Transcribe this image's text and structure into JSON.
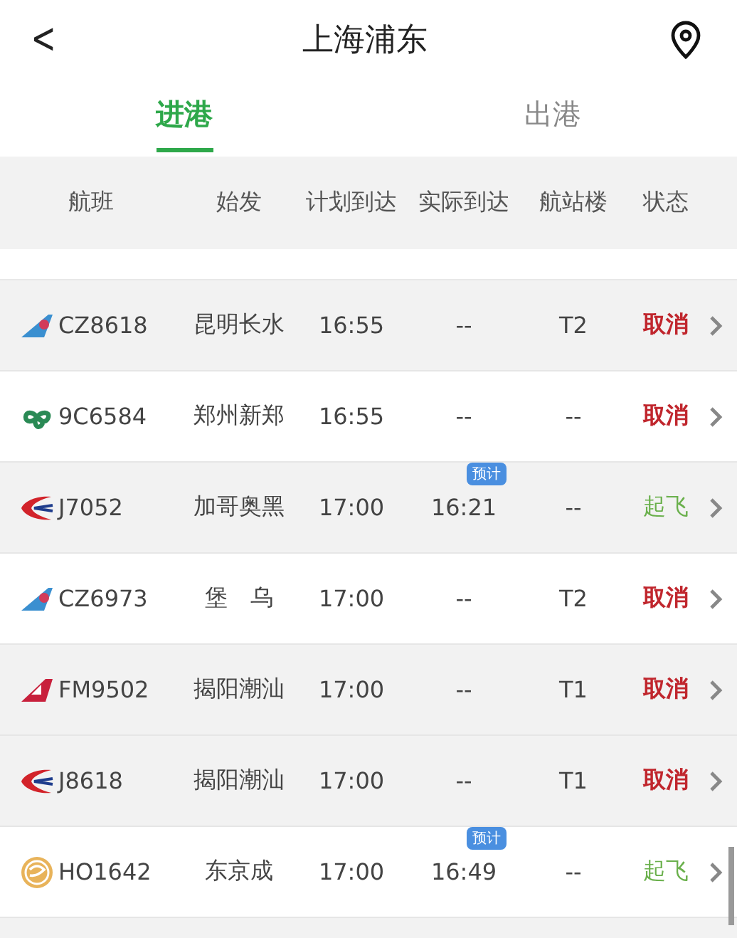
{
  "header": {
    "back": "<",
    "title": "上海浦东"
  },
  "tabs": [
    {
      "label": "进港",
      "selected": true
    },
    {
      "label": "出港",
      "selected": false
    }
  ],
  "table": {
    "columns": [
      "航班",
      "始发",
      "计划到达",
      "实际到达",
      "航站楼",
      "状态"
    ],
    "rows": [
      {
        "logo": {
          "kind": "wing"
        },
        "flight": "CZ8618",
        "origin": "昆明长水",
        "planned": "16:55",
        "actual": "--",
        "terminal": "T2",
        "status": "取消",
        "kind": "cancelled",
        "highlighted": true
      },
      {
        "logo": {
          "kind": "clover"
        },
        "flight": "9C6584",
        "origin": "郑州新郑",
        "planned": "16:55",
        "actual": "--",
        "terminal": "--",
        "status": "取消",
        "kind": "cancelled",
        "highlighted": false
      },
      {
        "logo": {
          "kind": "swallow"
        },
        "flight": "J7052",
        "origin": "加哥奥黑",
        "planned": "17:00",
        "actual": "16:21",
        "badge": "预计",
        "terminal": "--",
        "status": "起飞",
        "kind": "departed",
        "highlighted": true
      },
      {
        "logo": {
          "kind": "wing"
        },
        "flight": "CZ6973",
        "origin": "堡　乌",
        "planned": "17:00",
        "actual": "--",
        "terminal": "T2",
        "status": "取消",
        "kind": "cancelled",
        "highlighted": false
      },
      {
        "logo": {
          "kind": "tail"
        },
        "flight": "FM9502",
        "origin": "揭阳潮汕",
        "planned": "17:00",
        "actual": "--",
        "terminal": "T1",
        "status": "取消",
        "kind": "cancelled",
        "highlighted": true
      },
      {
        "logo": {
          "kind": "swallow"
        },
        "flight": "J8618",
        "origin": "揭阳潮汕",
        "planned": "17:00",
        "actual": "--",
        "terminal": "T1",
        "status": "取消",
        "kind": "cancelled",
        "highlighted": true
      },
      {
        "logo": {
          "kind": "seal"
        },
        "flight": "HO1642",
        "origin": "东京成",
        "planned": "17:00",
        "actual": "16:49",
        "badge": "预计",
        "terminal": "--",
        "status": "起飞",
        "kind": "departed",
        "highlighted": false
      }
    ]
  }
}
